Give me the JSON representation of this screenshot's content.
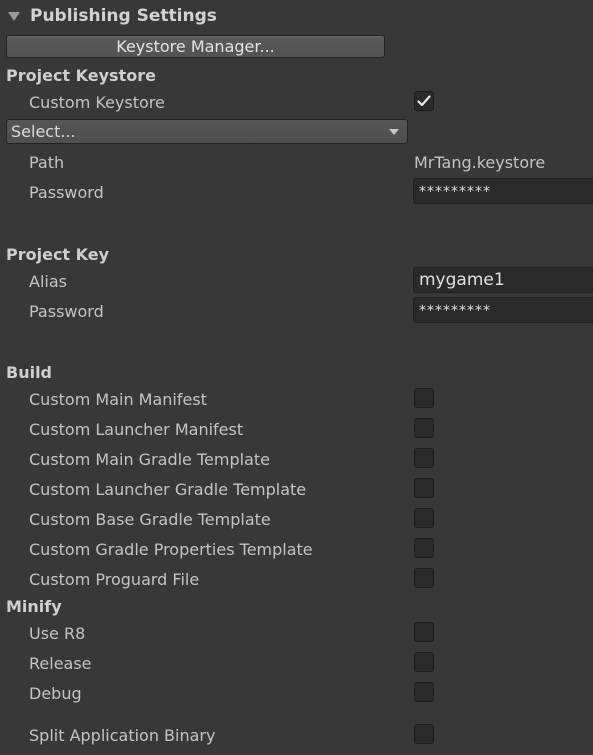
{
  "foldout": {
    "title": "Publishing Settings"
  },
  "keystore_manager_button": "Keystore Manager...",
  "project_keystore": {
    "heading": "Project Keystore",
    "custom_keystore_label": "Custom Keystore",
    "custom_keystore_checked": true,
    "select_value": "Select...",
    "path_label": "Path",
    "path_value": "MrTang.keystore",
    "password_label": "Password",
    "password_value": "*********"
  },
  "project_key": {
    "heading": "Project Key",
    "alias_label": "Alias",
    "alias_value": "mygame1",
    "password_label": "Password",
    "password_value": "*********"
  },
  "build": {
    "heading": "Build",
    "items": [
      {
        "label": "Custom Main Manifest",
        "checked": false
      },
      {
        "label": "Custom Launcher Manifest",
        "checked": false
      },
      {
        "label": "Custom Main Gradle Template",
        "checked": false
      },
      {
        "label": "Custom Launcher Gradle Template",
        "checked": false
      },
      {
        "label": "Custom Base Gradle Template",
        "checked": false
      },
      {
        "label": "Custom Gradle Properties Template",
        "checked": false
      },
      {
        "label": "Custom Proguard File",
        "checked": false
      }
    ]
  },
  "minify": {
    "heading": "Minify",
    "items": [
      {
        "label": "Use R8",
        "checked": false
      },
      {
        "label": "Release",
        "checked": false
      },
      {
        "label": "Debug",
        "checked": false
      }
    ]
  },
  "split_binary": {
    "label": "Split Application Binary",
    "checked": false
  }
}
